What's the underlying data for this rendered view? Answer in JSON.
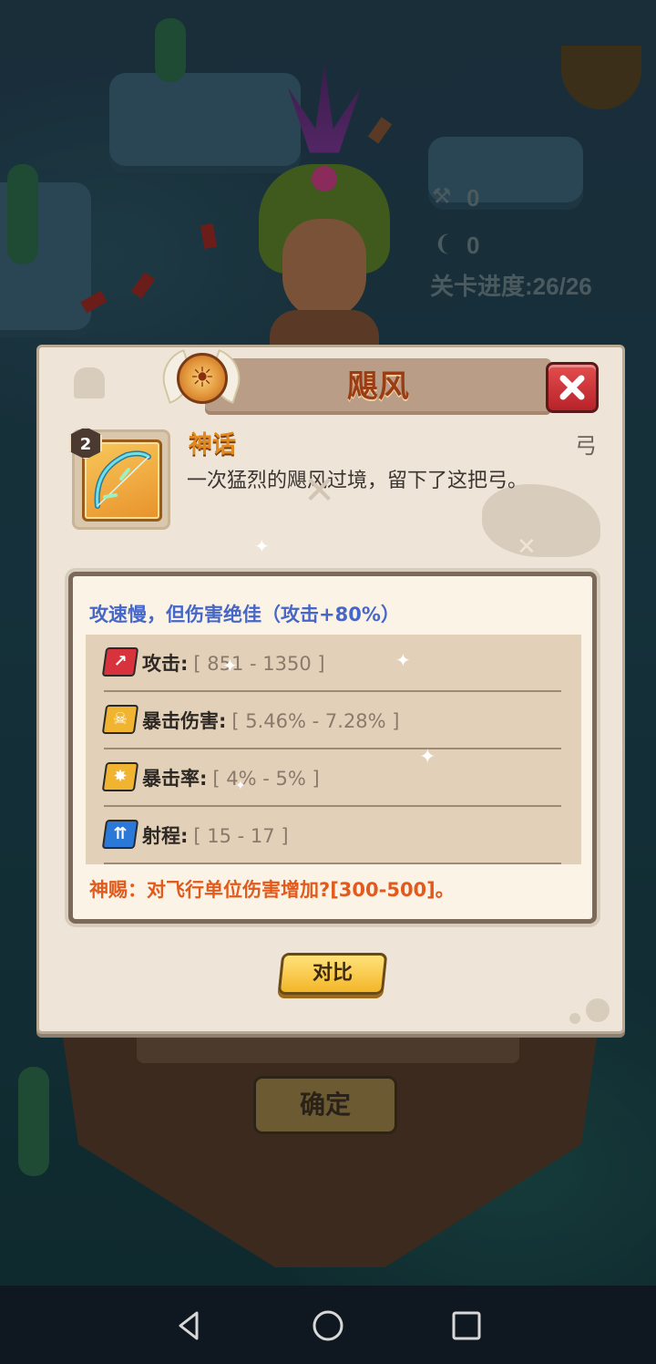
{
  "background": {
    "hud": {
      "tools_count": "0",
      "horns_count": "0",
      "progress_label": "关卡进度:",
      "progress_value": "26/26"
    },
    "confirm_button_label": "确定"
  },
  "dialog": {
    "title": "飓风",
    "rarity": "神话",
    "weapon_type": "弓",
    "item_level": "2",
    "description": "一次猛烈的飓风过境，留下了这把弓。",
    "headline": "攻速慢，但伤害绝佳（攻击+80%）",
    "stats": [
      {
        "label": "攻击:",
        "value": "[ 851 - 1350 ]",
        "icon": "attack-icon",
        "color": "#d8323c"
      },
      {
        "label": "暴击伤害:",
        "value": "[ 5.46% - 7.28% ]",
        "icon": "crit-damage-icon",
        "color": "#f0b430"
      },
      {
        "label": "暴击率:",
        "value": "[ 4% - 5% ]",
        "icon": "crit-rate-icon",
        "color": "#f0b430"
      },
      {
        "label": "射程:",
        "value": "[ 15 - 17 ]",
        "icon": "range-icon",
        "color": "#2a78d8"
      }
    ],
    "blessing_prefix": "神赐：对飞行单位伤害增加?",
    "blessing_value": "[300-500]",
    "blessing_suffix": "。",
    "compare_button_label": "对比"
  },
  "colors": {
    "title": "#9b3d14",
    "rarity": "#e0891c",
    "headline": "#4667c8",
    "blessing": "#e25a1c",
    "close_button": "#d33a3e"
  }
}
